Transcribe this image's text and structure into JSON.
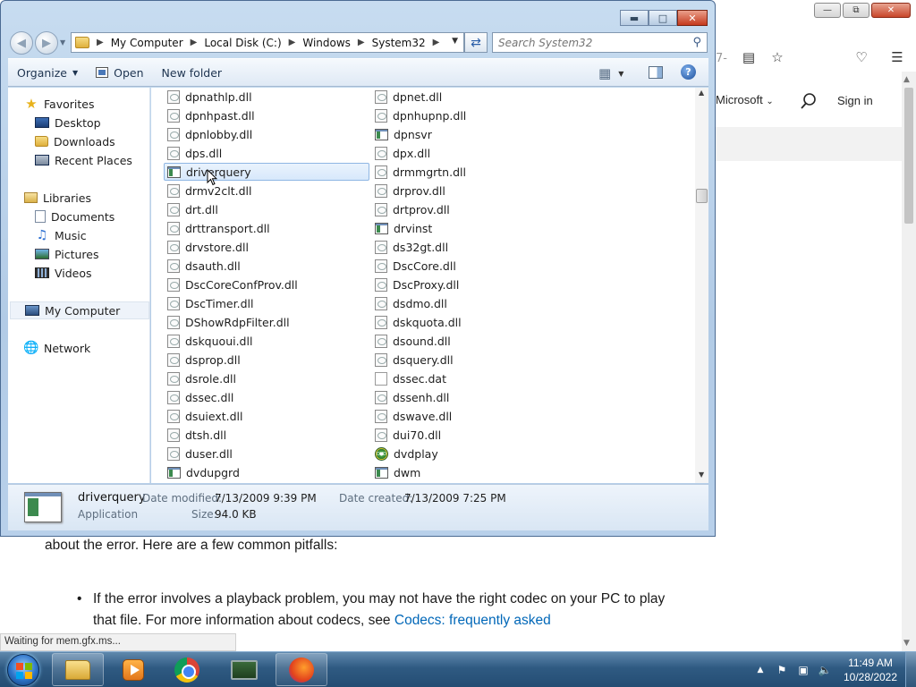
{
  "browser": {
    "url_fragment": "7-",
    "nav_microsoft": "Microsoft",
    "nav_signin": "Sign in",
    "article_para": "about the error. Here are a few common pitfalls:",
    "article_bullet_text": "If the error involves a playback problem, you may not have the right codec on your PC to play that file. For more information about codecs, see ",
    "article_link": "Codecs: frequently asked",
    "status_text": "Waiting for mem.gfx.ms..."
  },
  "explorer": {
    "address": {
      "crumbs": [
        "My Computer",
        "Local Disk (C:)",
        "Windows",
        "System32"
      ]
    },
    "search": {
      "placeholder": "Search System32"
    },
    "toolbar": {
      "organize": "Organize",
      "open": "Open",
      "new_folder": "New folder",
      "help": "?"
    },
    "nav": {
      "favorites": "Favorites",
      "desktop": "Desktop",
      "downloads": "Downloads",
      "recent_places": "Recent Places",
      "libraries": "Libraries",
      "documents": "Documents",
      "music": "Music",
      "pictures": "Pictures",
      "videos": "Videos",
      "my_computer": "My Computer",
      "network": "Network"
    },
    "files_col1": [
      {
        "name": "dpnathlp.dll",
        "type": "dll"
      },
      {
        "name": "dpnhpast.dll",
        "type": "dll"
      },
      {
        "name": "dpnlobby.dll",
        "type": "dll"
      },
      {
        "name": "dps.dll",
        "type": "dll"
      },
      {
        "name": "driverquery",
        "type": "app",
        "selected": true
      },
      {
        "name": "drmv2clt.dll",
        "type": "dll"
      },
      {
        "name": "drt.dll",
        "type": "dll"
      },
      {
        "name": "drttransport.dll",
        "type": "dll"
      },
      {
        "name": "drvstore.dll",
        "type": "dll"
      },
      {
        "name": "dsauth.dll",
        "type": "dll"
      },
      {
        "name": "DscCoreConfProv.dll",
        "type": "dll"
      },
      {
        "name": "DscTimer.dll",
        "type": "dll"
      },
      {
        "name": "DShowRdpFilter.dll",
        "type": "dll"
      },
      {
        "name": "dskquoui.dll",
        "type": "dll"
      },
      {
        "name": "dsprop.dll",
        "type": "dll"
      },
      {
        "name": "dsrole.dll",
        "type": "dll"
      },
      {
        "name": "dssec.dll",
        "type": "dll"
      },
      {
        "name": "dsuiext.dll",
        "type": "dll"
      },
      {
        "name": "dtsh.dll",
        "type": "dll"
      },
      {
        "name": "duser.dll",
        "type": "dll"
      },
      {
        "name": "dvdupgrd",
        "type": "app"
      }
    ],
    "files_col2": [
      {
        "name": "dpnet.dll",
        "type": "dll"
      },
      {
        "name": "dpnhupnp.dll",
        "type": "dll"
      },
      {
        "name": "dpnsvr",
        "type": "app"
      },
      {
        "name": "dpx.dll",
        "type": "dll"
      },
      {
        "name": "drmmgrtn.dll",
        "type": "dll"
      },
      {
        "name": "drprov.dll",
        "type": "dll"
      },
      {
        "name": "drtprov.dll",
        "type": "dll"
      },
      {
        "name": "drvinst",
        "type": "app"
      },
      {
        "name": "ds32gt.dll",
        "type": "dll"
      },
      {
        "name": "DscCore.dll",
        "type": "dll"
      },
      {
        "name": "DscProxy.dll",
        "type": "dll"
      },
      {
        "name": "dsdmo.dll",
        "type": "dll"
      },
      {
        "name": "dskquota.dll",
        "type": "dll"
      },
      {
        "name": "dsound.dll",
        "type": "dll"
      },
      {
        "name": "dsquery.dll",
        "type": "dll"
      },
      {
        "name": "dssec.dat",
        "type": "dat"
      },
      {
        "name": "dssenh.dll",
        "type": "dll"
      },
      {
        "name": "dswave.dll",
        "type": "dll"
      },
      {
        "name": "dui70.dll",
        "type": "dll"
      },
      {
        "name": "dvdplay",
        "type": "dvd"
      },
      {
        "name": "dwm",
        "type": "app"
      }
    ],
    "details": {
      "name": "driverquery",
      "kind": "Application",
      "modified_label": "Date modified:",
      "modified_value": "7/13/2009 9:39 PM",
      "created_label": "Date created:",
      "created_value": "7/13/2009 7:25 PM",
      "size_label": "Size:",
      "size_value": "94.0 KB"
    }
  },
  "taskbar": {
    "time": "11:49 AM",
    "date": "10/28/2022"
  }
}
